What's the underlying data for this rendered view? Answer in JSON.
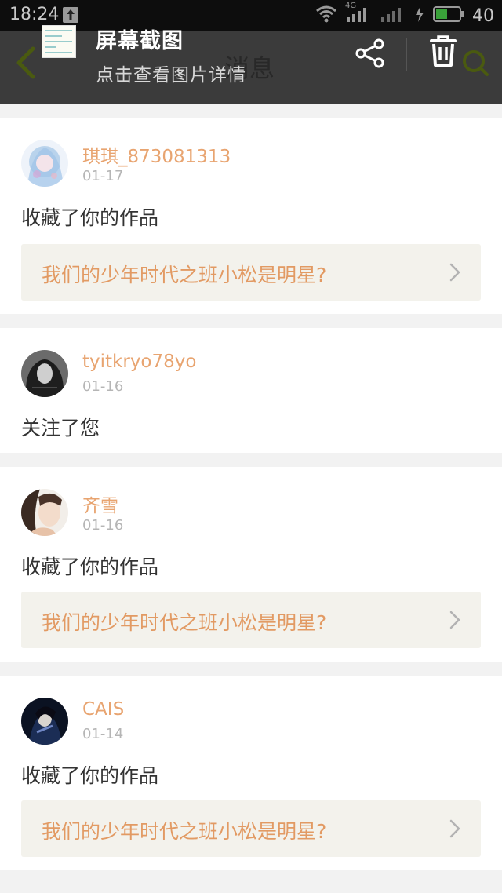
{
  "status_bar": {
    "time": "18:24",
    "network": "4G",
    "battery_level": "40"
  },
  "header": {
    "page_title": "消息",
    "screenshot_title": "屏幕截图",
    "screenshot_subtitle": "点击查看图片详情"
  },
  "messages": [
    {
      "user": "琪琪_873081313",
      "date": "01-17",
      "action": "收藏了你的作品",
      "work_title": "我们的少年时代之班小松是明星?"
    },
    {
      "user": "tyitkryo78yo",
      "date": "01-16",
      "action": "关注了您"
    },
    {
      "user": "齐雪",
      "date": "01-16",
      "action": "收藏了你的作品",
      "work_title": "我们的少年时代之班小松是明星?"
    },
    {
      "user": "CAIS",
      "date": "01-14",
      "action": "收藏了你的作品",
      "work_title": "我们的少年时代之班小松是明星?"
    }
  ],
  "colors": {
    "accent": "#e29a63",
    "username": "#e8a470",
    "work_bg": "#f3f2ec",
    "header_bg": "#3b3b3b"
  },
  "icons": {
    "back": "chevron-left-icon",
    "share": "share-icon",
    "trash": "trash-icon",
    "search": "search-icon",
    "chevron": "chevron-right-icon"
  }
}
